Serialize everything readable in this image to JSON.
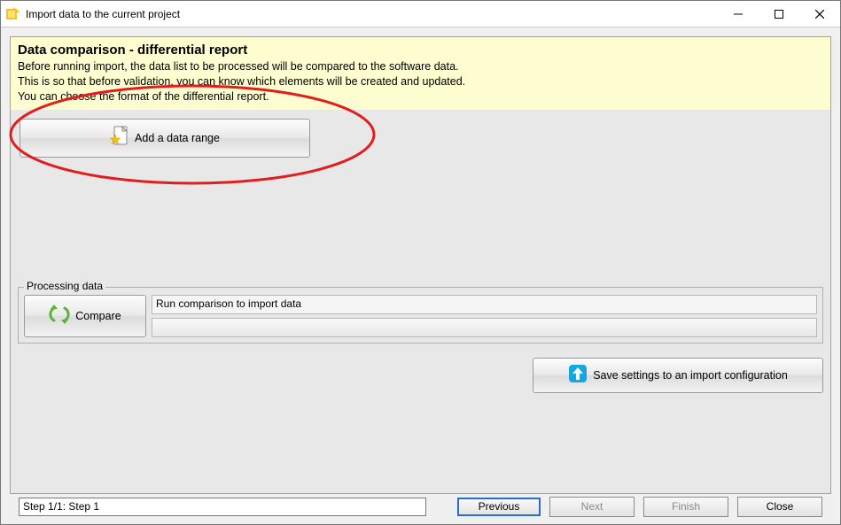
{
  "window": {
    "title": "Import data to the current project"
  },
  "banner": {
    "title": "Data comparison - differential report",
    "line1": "Before running import, the data list to be processed will be compared to the software data.",
    "line2": "This is so that before validation, you can know which elements will be created and updated.",
    "line3": "You can choose the format of the differential report."
  },
  "buttons": {
    "add_range": "Add a data range",
    "compare": "Compare",
    "save_settings": "Save settings to an import configuration",
    "previous": "Previous",
    "next": "Next",
    "finish": "Finish",
    "close": "Close"
  },
  "processing": {
    "legend": "Processing data",
    "message": "Run comparison to import data"
  },
  "footer": {
    "step": "Step 1/1: Step 1"
  }
}
